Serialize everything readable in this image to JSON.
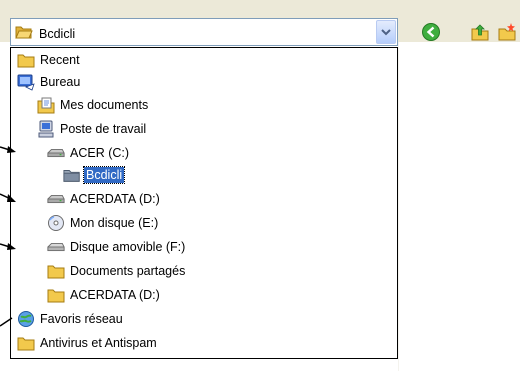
{
  "combo": {
    "selected_label": "Bcdicli",
    "icon": "folder-open-icon"
  },
  "toolbar": {
    "buttons": [
      {
        "name": "back-button",
        "icon": "green-back-arrow-icon"
      },
      {
        "name": "up-folder-button",
        "icon": "folder-up-icon"
      },
      {
        "name": "new-folder-button",
        "icon": "new-folder-icon"
      }
    ]
  },
  "dropdown": {
    "items": [
      {
        "label": "Recent",
        "icon": "folder-icon",
        "level": 0
      },
      {
        "label": "Bureau",
        "icon": "desktop-icon",
        "level": 0
      },
      {
        "label": "Mes documents",
        "icon": "my-documents-icon",
        "level": 1
      },
      {
        "label": "Poste de travail",
        "icon": "my-computer-icon",
        "level": 1
      },
      {
        "label": "ACER (C:)",
        "icon": "hard-drive-icon",
        "level": 2
      },
      {
        "label": "Bcdicli",
        "icon": "folder-open-icon",
        "level": 3,
        "selected": true
      },
      {
        "label": "ACERDATA (D:)",
        "icon": "hard-drive-icon",
        "level": 2
      },
      {
        "label": "Mon disque (E:)",
        "icon": "cd-drive-icon",
        "level": 2
      },
      {
        "label": "Disque amovible (F:)",
        "icon": "removable-drive-icon",
        "level": 2
      },
      {
        "label": "Documents partagés",
        "icon": "folder-icon",
        "level": 2
      },
      {
        "label": "ACERDATA (D:)",
        "icon": "folder-icon",
        "level": 2
      },
      {
        "label": "Favoris réseau",
        "icon": "network-places-icon",
        "level": 0
      },
      {
        "label": "Antivirus et Antispam",
        "icon": "folder-icon",
        "level": 0
      }
    ]
  },
  "colors": {
    "selection": "#316ac5",
    "folder": "#f2c94c",
    "window_bg": "#ece9d8"
  }
}
